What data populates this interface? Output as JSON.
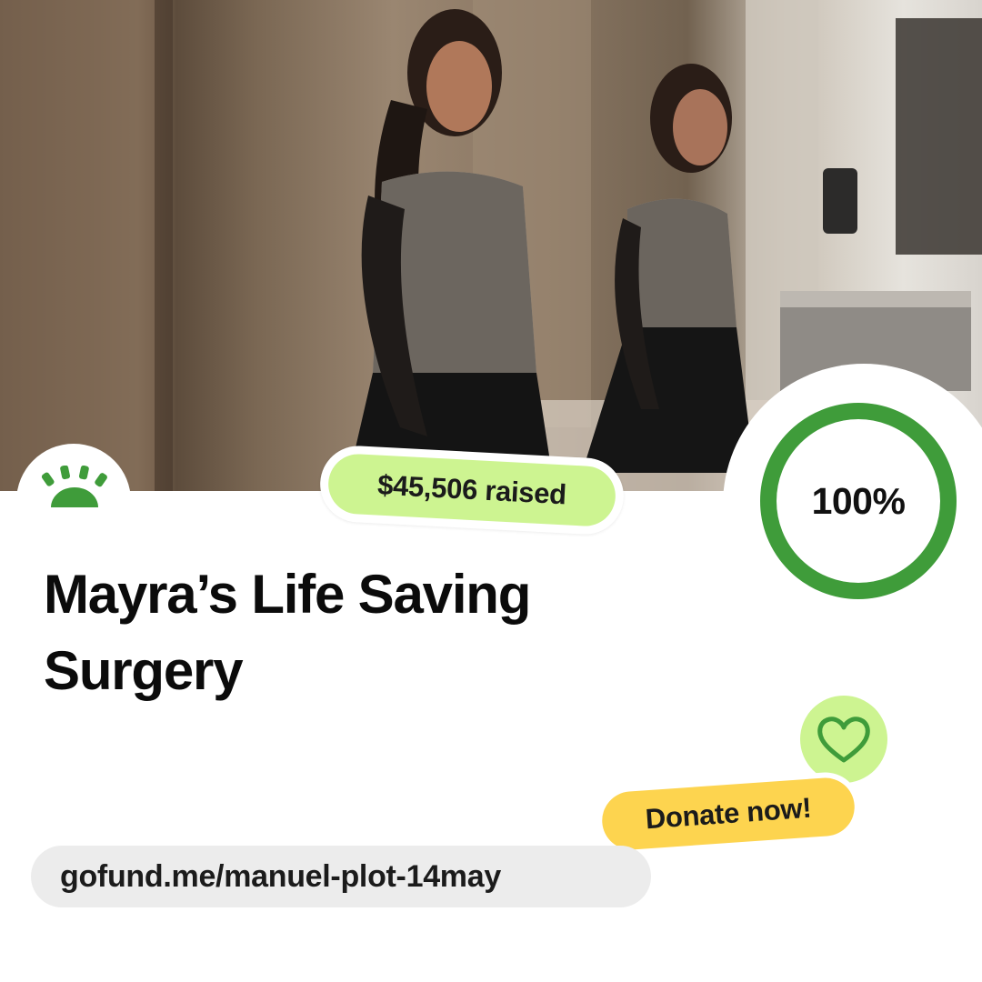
{
  "campaign": {
    "title": "Mayra’s Life Saving Surgery",
    "raised_label": "$45,506 raised",
    "progress_label": "100%",
    "progress_fraction": 1.0,
    "donate_label": "Donate now!",
    "url": "gofund.me/manuel-plot-14may"
  },
  "colors": {
    "brand_green": "#3f9c3a",
    "raised_pill": "#cdf491",
    "donate_pill": "#fdd44f",
    "heart_bubble": "#cdf491",
    "url_pill": "#ececec",
    "ring_track": "#e4efe0"
  },
  "icons": {
    "logo": "gofundme-logo-icon",
    "heart": "heart-icon"
  }
}
